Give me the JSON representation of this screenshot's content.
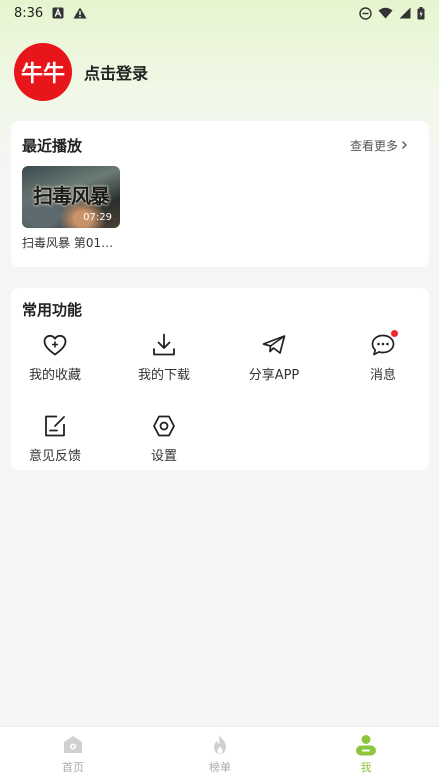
{
  "status_bar": {
    "time": "8:36",
    "icons_left": [
      "a-notification-icon",
      "warning-icon"
    ],
    "icons_right": [
      "dnd-icon",
      "wifi-icon",
      "signal-icon",
      "battery-icon"
    ]
  },
  "profile": {
    "avatar_text": "牛牛",
    "avatar_color": "#e8151b",
    "login_label": "点击登录"
  },
  "recent": {
    "title": "最近播放",
    "see_more": "查看更多",
    "see_more_icon": "chevron-right-icon",
    "items": [
      {
        "poster_title": "扫毒风暴",
        "duration": "07:29",
        "label": "扫毒风暴 第01…"
      }
    ]
  },
  "functions": {
    "title": "常用功能",
    "items": [
      {
        "label": "我的收藏",
        "icon": "heart-plus-icon"
      },
      {
        "label": "我的下载",
        "icon": "download-icon"
      },
      {
        "label": "分享APP",
        "icon": "paper-plane-icon"
      },
      {
        "label": "消息",
        "icon": "message-icon",
        "badge": true
      },
      {
        "label": "意见反馈",
        "icon": "feedback-icon"
      },
      {
        "label": "设置",
        "icon": "settings-icon"
      }
    ]
  },
  "bottom_nav": {
    "items": [
      {
        "label": "首页",
        "icon": "home-icon",
        "active": false
      },
      {
        "label": "榜单",
        "icon": "flame-icon",
        "active": false
      },
      {
        "label": "我",
        "icon": "person-icon",
        "active": true
      }
    ]
  },
  "colors": {
    "accent": "#8cc63f",
    "badge": "#f3262c",
    "header_gradient_top": "#e6f5cf"
  }
}
